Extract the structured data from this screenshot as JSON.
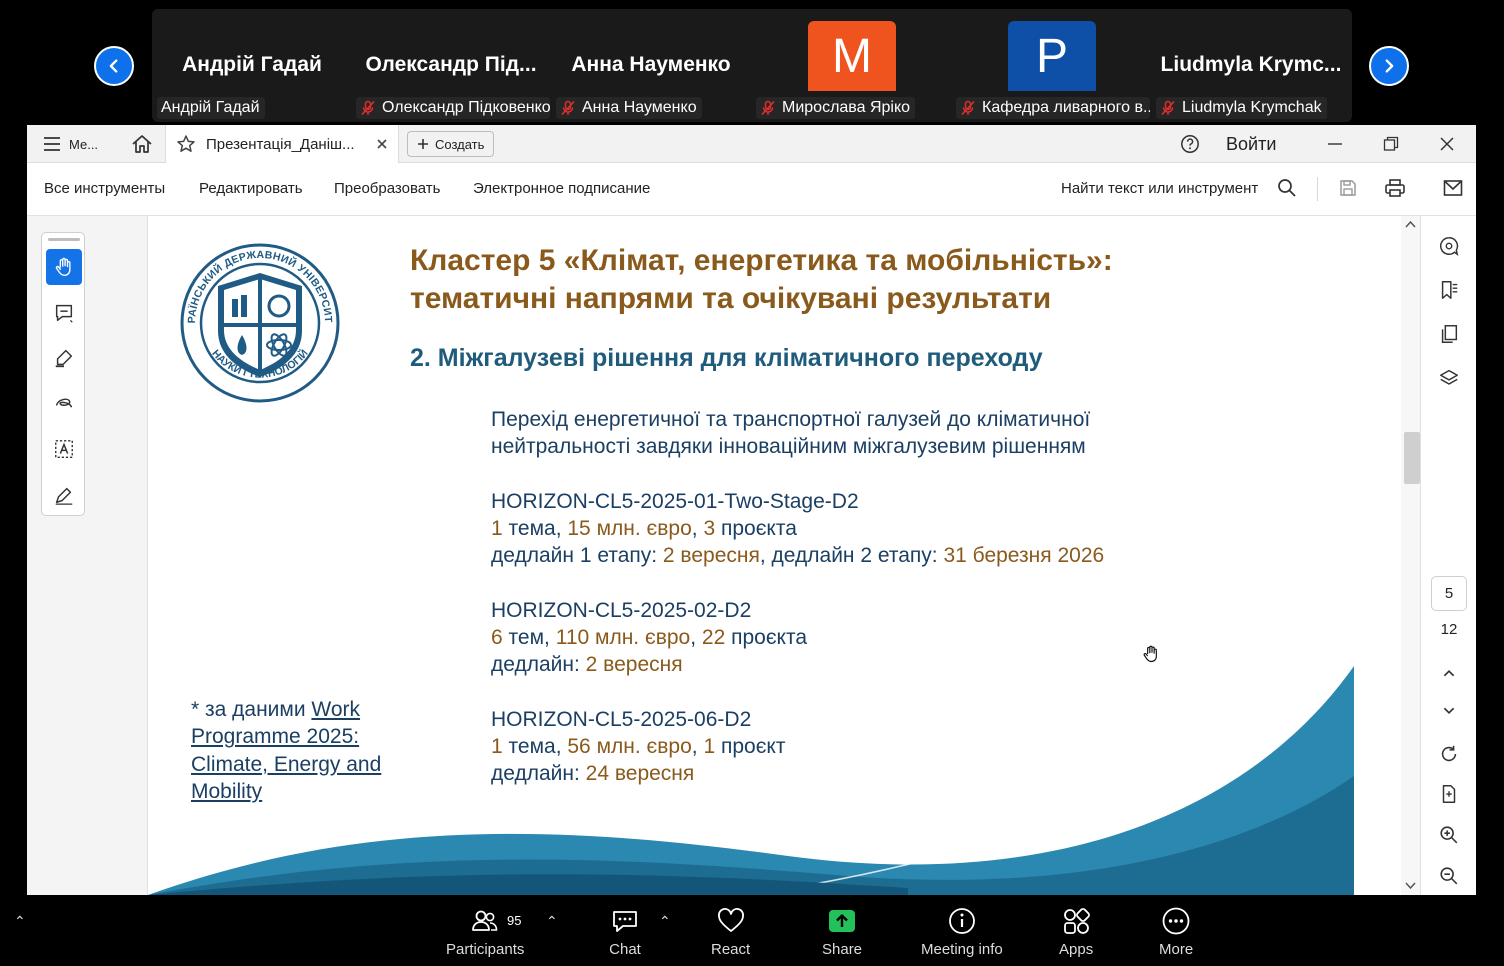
{
  "participants": {
    "tiles": [
      {
        "big_name": "Андрій Гадай",
        "label": "Андрій Гадай",
        "muted": false
      },
      {
        "big_name": "Олександр  Під...",
        "label": "Олександр Підковенко",
        "muted": true
      },
      {
        "big_name": "Анна Науменко",
        "label": "Анна Науменко",
        "muted": true
      },
      {
        "avatar_letter": "M",
        "avatar_color": "#f0541e",
        "label": "Мирослава Яріко",
        "muted": true
      },
      {
        "avatar_letter": "P",
        "avatar_color": "#0e4fa8",
        "label": "Кафедра ливарного в...",
        "muted": true
      },
      {
        "big_name": "Liudmyla  Krymc...",
        "label": "Liudmyla Krymchak",
        "muted": true
      }
    ]
  },
  "acrobat": {
    "menu_tab": "Ме...",
    "doc_tab": "Презентація_Даніш...",
    "create_label": "Создать",
    "signin_label": "Войти",
    "menu_items": [
      "Все инструменты",
      "Редактировать",
      "Преобразовать",
      "Электронное подписание"
    ],
    "search_label": "Найти текст или инструмент",
    "page_current": "5",
    "page_total": "12"
  },
  "slide": {
    "title_line1": "Кластер 5 «Клімат, енергетика та мобільність»:",
    "title_line2": "тематичні напрями та очікувані результати",
    "subtitle": "2. Міжгалузеві рішення для кліматичного переходу",
    "intro_line1": "Перехід енергетичної та транспортної галузей до кліматичної",
    "intro_line2": "нейтральності завдяки інноваційним міжгалузевим рішенням",
    "calls": [
      {
        "code": "HORIZON-CL5-2025-01-Two-Stage-D2",
        "topics_num": "1",
        "topics_word": " тема, ",
        "budget_num": "15 млн. євро",
        "sep": ", ",
        "projects_num": "3",
        "projects_word": " проєкта",
        "dl_label": "дедлайн 1 етапу: ",
        "dl_value": "2 вересня",
        "dl2_label": ", дедлайн 2 етапу: ",
        "dl2_value": "31 березня 2026"
      },
      {
        "code": "HORIZON-CL5-2025-02-D2",
        "topics_num": "6",
        "topics_word": " тем, ",
        "budget_num": "110 млн. євро",
        "sep": ", ",
        "projects_num": "22",
        "projects_word": " проєкта",
        "dl_label": "дедлайн: ",
        "dl_value": "2 вересня"
      },
      {
        "code": "HORIZON-CL5-2025-06-D2",
        "topics_num": "1",
        "topics_word": " тема, ",
        "budget_num": "56 млн. євро",
        "sep": ", ",
        "projects_num": "1",
        "projects_word": " проєкт",
        "dl_label": "дедлайн: ",
        "dl_value": "24 вересня"
      }
    ],
    "footnote_prefix": "* за даними ",
    "footnote_link_1": "Work",
    "footnote_link_2": "Programme 2025:",
    "footnote_link_3": "Climate, Energy and",
    "footnote_link_4": "Mobility",
    "logo_ring_top": "УКРАЇНСЬКИЙ ДЕРЖАВНИЙ УНІВЕРСИТЕТ",
    "logo_ring_bottom": "НАУКИ І ТЕХНОЛОГІЙ"
  },
  "zoom": {
    "participants_label": "Participants",
    "participants_count": "95",
    "chat_label": "Chat",
    "react_label": "React",
    "share_label": "Share",
    "meeting_info_label": "Meeting info",
    "apps_label": "Apps",
    "more_label": "More"
  },
  "colors": {
    "zoom_blue": "#0e71eb",
    "share_green": "#24c15a",
    "acrobat_blue": "#1473e6",
    "title_brown": "#8a5a1c",
    "text_navy": "#1b3f63",
    "wave_teal": "#1f7fa6"
  }
}
